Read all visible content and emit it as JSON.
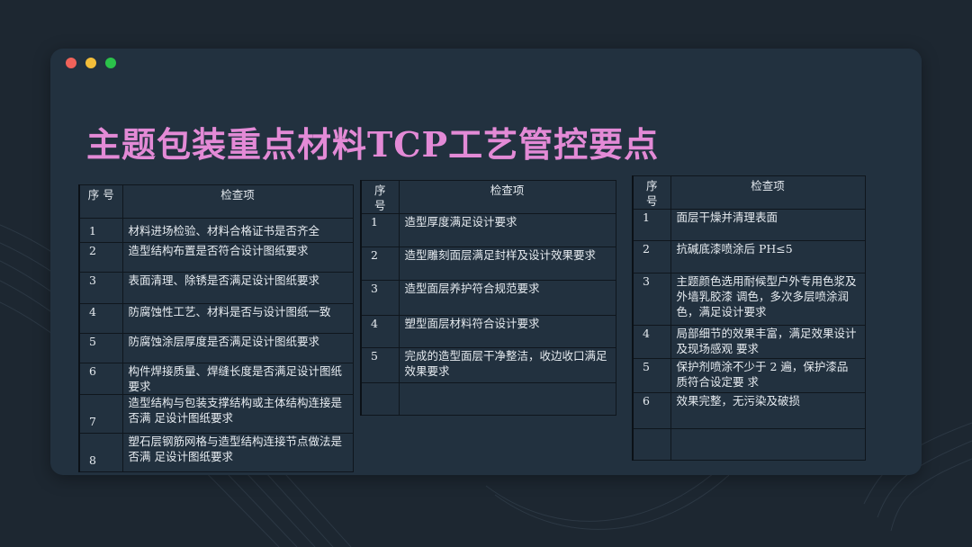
{
  "window": {
    "controls": [
      "close",
      "minimize",
      "maximize"
    ],
    "colors": {
      "close": "#f0625a",
      "minimize": "#f3be3a",
      "maximize": "#2bc24a"
    }
  },
  "page": {
    "title": "主题包装重点材料TCP工艺管控要点",
    "title_color": "#e38ad6"
  },
  "tables": [
    {
      "header": {
        "seq": "序 号",
        "item": "检查项"
      },
      "rows": [
        {
          "seq": "1",
          "item": "材料进场检验、材料合格证书是否齐全"
        },
        {
          "seq": "2",
          "item": "造型结构布置是否符合设计图纸要求"
        },
        {
          "seq": "3",
          "item": "表面清理、除锈是否满足设计图纸要求"
        },
        {
          "seq": "4",
          "item": "防腐蚀性工艺、材料是否与设计图纸一致"
        },
        {
          "seq": "5",
          "item": "防腐蚀涂层厚度是否满足设计图纸要求"
        },
        {
          "seq": "6",
          "item": "构件焊接质量、焊缝长度是否满足设计图纸要求"
        },
        {
          "seq": "7",
          "item": "造型结构与包装支撑结构或主体结构连接是否满 足设计图纸要求"
        },
        {
          "seq": "8",
          "item": "塑石层钢筋网格与造型结构连接节点做法是否满 足设计图纸要求"
        }
      ]
    },
    {
      "header": {
        "seq": "序 号",
        "item": "检查项"
      },
      "rows": [
        {
          "seq": "1",
          "item": "造型厚度满足设计要求"
        },
        {
          "seq": "2",
          "item": "造型雕刻面层满足封样及设计效果要求"
        },
        {
          "seq": "3",
          "item": "造型面层养护符合规范要求"
        },
        {
          "seq": "4",
          "item": "塑型面层材料符合设计要求"
        },
        {
          "seq": "5",
          "item": "完成的造型面层干净整洁，收边收口满足效果要求"
        },
        {
          "seq": "",
          "item": ""
        }
      ]
    },
    {
      "header": {
        "seq": "序 号",
        "item": "检查项"
      },
      "rows": [
        {
          "seq": "1",
          "item": "面层干燥并清理表面"
        },
        {
          "seq": "2",
          "item": "抗碱底漆喷涂后 PH≤5"
        },
        {
          "seq": "3",
          "item": "主题颜色选用耐候型户外专用色浆及外墙乳胶漆 调色，多次多层喷涂润色，满足设计要求"
        },
        {
          "seq": "4",
          "item": "局部细节的效果丰富，满足效果设计及现场感观 要求"
        },
        {
          "seq": "5",
          "item": "保护剂喷涂不少于 2 遍，保护漆品质符合设定要 求"
        },
        {
          "seq": "6",
          "item": "效果完整，无污染及破损"
        },
        {
          "seq": "",
          "item": ""
        }
      ]
    }
  ]
}
